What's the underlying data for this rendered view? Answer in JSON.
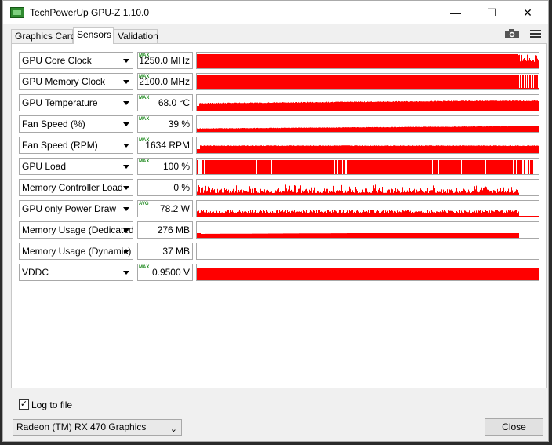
{
  "window": {
    "title": "TechPowerUp GPU-Z 1.10.0",
    "minimize": "—",
    "maximize": "☐",
    "close": "✕"
  },
  "tabs": [
    {
      "label": "Graphics Card",
      "active": false
    },
    {
      "label": "Sensors",
      "active": true
    },
    {
      "label": "Validation",
      "active": false
    }
  ],
  "toolbar": {
    "camera_icon": "camera-icon",
    "menu_icon": "hamburger-menu-icon"
  },
  "accent_color": "#ff0000",
  "sensors": [
    {
      "name": "GPU Core Clock",
      "value": "1250.0 MHz",
      "badge": "MAX",
      "graph": "full-noisy-end"
    },
    {
      "name": "GPU Memory Clock",
      "value": "2100.0 MHz",
      "badge": "MAX",
      "graph": "full-striped-end"
    },
    {
      "name": "GPU Temperature",
      "value": "68.0 °C",
      "badge": "MAX",
      "graph": "ramp"
    },
    {
      "name": "Fan Speed (%)",
      "value": "39 %",
      "badge": "MAX",
      "graph": "low-ramp"
    },
    {
      "name": "Fan Speed (RPM)",
      "value": "1634 RPM",
      "badge": "MAX",
      "graph": "mid"
    },
    {
      "name": "GPU Load",
      "value": "100 %",
      "badge": "MAX",
      "graph": "load"
    },
    {
      "name": "Memory Controller Load",
      "value": "0 %",
      "badge": "",
      "graph": "spiky"
    },
    {
      "name": "GPU only Power Draw",
      "value": "78.2 W",
      "badge": "AVG",
      "graph": "power"
    },
    {
      "name": "Memory Usage (Dedicated)",
      "value": "276 MB",
      "badge": "",
      "graph": "mem"
    },
    {
      "name": "Memory Usage (Dynamic)",
      "value": "37 MB",
      "badge": "",
      "graph": "empty"
    },
    {
      "name": "VDDC",
      "value": "0.9500 V",
      "badge": "MAX",
      "graph": "full"
    }
  ],
  "log_to_file": {
    "label": "Log to file",
    "checked": true
  },
  "gpu_select": {
    "value": "Radeon (TM) RX 470 Graphics"
  },
  "close_button": "Close"
}
